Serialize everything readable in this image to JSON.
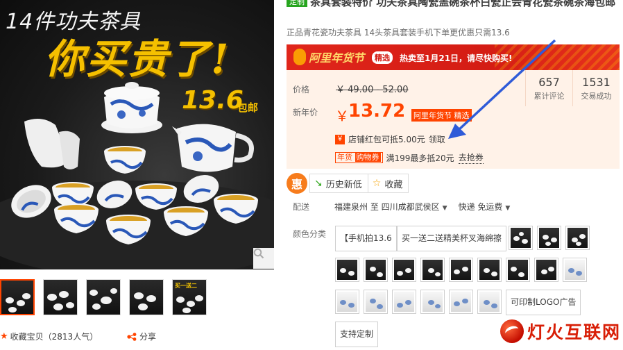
{
  "gallery": {
    "promo_top": "14件功夫茶具",
    "promo_big": "你买贵了!",
    "promo_price": "13.6",
    "promo_mail": "包邮",
    "thumb_text_4": "买一送二",
    "favorite_label": "收藏宝贝（2813人气）",
    "share_label": "分享"
  },
  "product": {
    "tag": "定制",
    "title": "茶具套装特价 功夫茶具陶瓷盖碗茶杯白瓷正会青花瓷茶碗茶海包邮",
    "subtitle": "正品青花瓷功夫茶具 14头茶具套装手机下单更优惠只需13.6"
  },
  "banner": {
    "festival": "阿里年货节",
    "badge": "精选",
    "note": "热卖至1月21日，请尽快购买!"
  },
  "price": {
    "label_price": "价格",
    "old_price": "￥ 49.00 - 52.00",
    "label_new": "新年价",
    "currency": "￥",
    "new_price": "13.72",
    "new_badge": "阿里年货节 精选",
    "stats": [
      {
        "num": "657",
        "label": "累计评论"
      },
      {
        "num": "1531",
        "label": "交易成功"
      }
    ],
    "coupon1_icon": "￥",
    "coupon1_text": "店铺红包可抵5.00元",
    "coupon1_link": "领取",
    "coupon2_tag_a": "年货",
    "coupon2_tag_b": "购物券",
    "coupon2_text": "满199最多抵20元",
    "coupon2_link": "去抢券"
  },
  "actions": {
    "hui": "惠",
    "history": "历史新低",
    "collect": "收藏"
  },
  "shipping": {
    "label": "配送",
    "from_to": "福建泉州 至  四川成都武侯区",
    "method": "快递 免运费"
  },
  "colors": {
    "label": "颜色分类",
    "text_options": [
      "【手机拍13.6",
      "买一送二送精美杯叉海绵擦",
      "可印制LOGO广告",
      "支持定制"
    ]
  },
  "watermark": "灯火互联网",
  "palette": {
    "accent": "#ff4400",
    "price_bg": "#fff2e8",
    "banner_red": "#d41c14",
    "tag_green": "#27a51f"
  }
}
